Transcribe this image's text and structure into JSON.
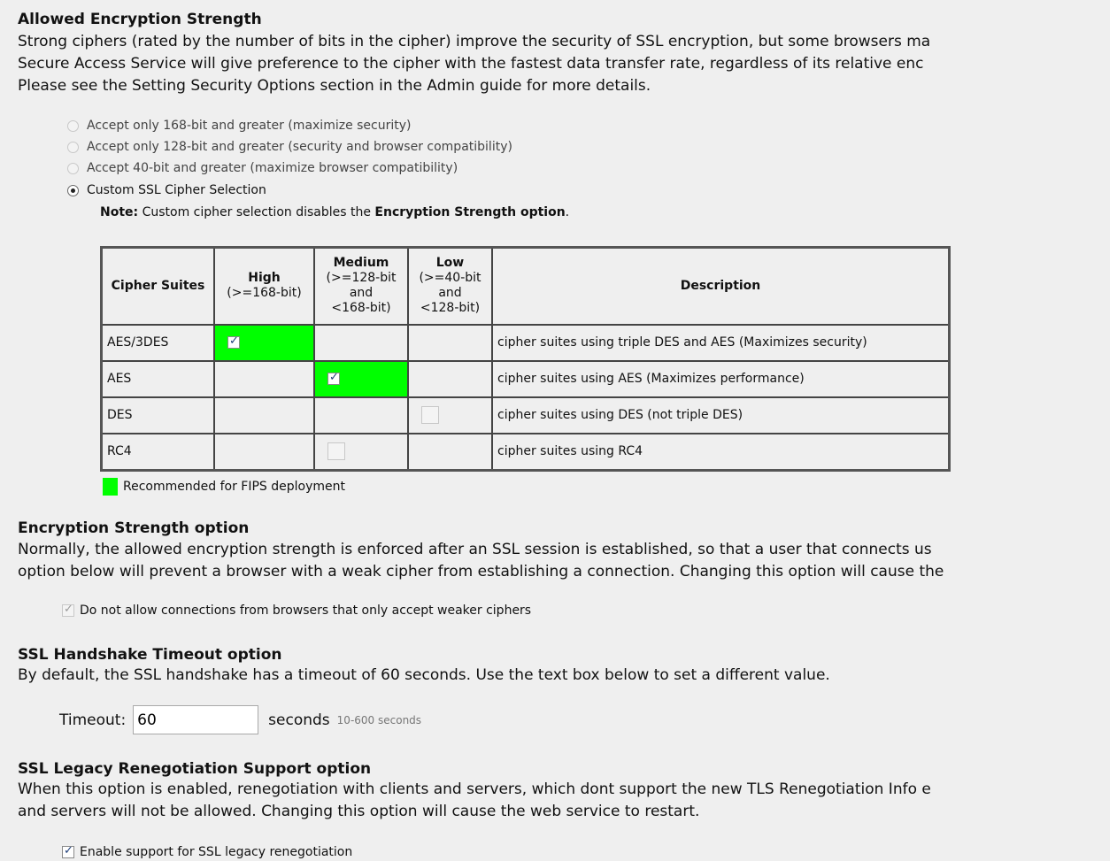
{
  "allowed": {
    "title": "Allowed Encryption Strength",
    "lines": [
      "Strong ciphers (rated by the number of bits in the cipher) improve the security of SSL encryption, but some browsers ma",
      "Secure Access Service will give preference to the cipher with the fastest data transfer rate, regardless of its relative enc",
      "Please see the Setting Security Options section in the Admin guide for more details."
    ],
    "options": [
      {
        "label": "Accept only 168-bit and greater (maximize security)",
        "selected": false
      },
      {
        "label": "Accept only 128-bit and greater (security and browser compatibility)",
        "selected": false
      },
      {
        "label": "Accept 40-bit and greater (maximize browser compatibility)",
        "selected": false
      },
      {
        "label": "Custom SSL Cipher Selection",
        "selected": true
      }
    ],
    "note_prefix": "Note:",
    "note_text": " Custom cipher selection disables the ",
    "note_bold": "Encryption Strength option",
    "note_end": "."
  },
  "table": {
    "headers": {
      "suites": "Cipher Suites",
      "high": "High",
      "high_sub": "(>=168-bit)",
      "medium": "Medium",
      "medium_sub1": "(>=128-bit",
      "medium_sub2": "and",
      "medium_sub3": "<168-bit)",
      "low": "Low",
      "low_sub1": "(>=40-bit",
      "low_sub2": "and",
      "low_sub3": "<128-bit)",
      "description": "Description"
    },
    "rows": [
      {
        "suite": "AES/3DES",
        "description": "cipher suites using triple DES and AES (Maximizes security)"
      },
      {
        "suite": "AES",
        "description": "cipher suites using AES (Maximizes performance)"
      },
      {
        "suite": "DES",
        "description": "cipher suites using DES (not triple DES)"
      },
      {
        "suite": "RC4",
        "description": "cipher suites using RC4"
      }
    ],
    "legend": "Recommended for FIPS deployment",
    "green": "#00ff00"
  },
  "strength": {
    "title": "Encryption Strength option",
    "lines": [
      "Normally, the allowed encryption strength is enforced after an SSL session is established, so that a user that connects us",
      "option below will prevent a browser with a weak cipher from establishing a connection. Changing this option will cause the"
    ],
    "checkbox_label": "Do not allow connections from browsers that only accept weaker ciphers"
  },
  "handshake": {
    "title": "SSL Handshake Timeout option",
    "line": "By default, the SSL handshake has a timeout of 60 seconds. Use the text box below to set a different value.",
    "timeout_label": "Timeout:",
    "timeout_value": "60",
    "unit": "seconds",
    "hint": "10-600 seconds"
  },
  "legacy": {
    "title": "SSL Legacy Renegotiation Support option",
    "lines": [
      "When this option is enabled, renegotiation with clients and servers, which dont support the new TLS Renegotiation Info e",
      "and servers will not be allowed. Changing this option will cause the web service to restart."
    ],
    "checkbox_label": "Enable support for SSL legacy renegotiation"
  }
}
